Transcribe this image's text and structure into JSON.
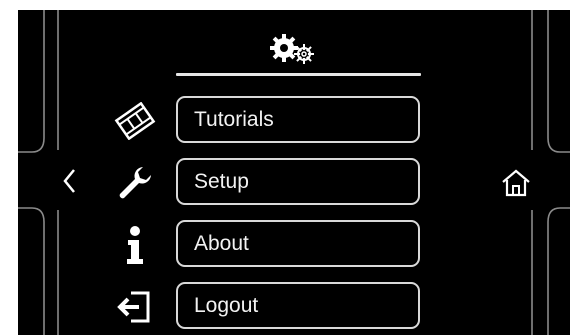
{
  "menu": {
    "items": [
      {
        "label": "Tutorials",
        "icon": "film-icon"
      },
      {
        "label": "Setup",
        "icon": "wrench-icon"
      },
      {
        "label": "About",
        "icon": "info-icon"
      },
      {
        "label": "Logout",
        "icon": "logout-icon"
      }
    ]
  },
  "header": {
    "icon": "gears-icon"
  },
  "nav": {
    "back_icon": "chevron-left-icon",
    "home_icon": "home-icon"
  },
  "colors": {
    "background": "#000000",
    "foreground": "#e6e6e6"
  }
}
